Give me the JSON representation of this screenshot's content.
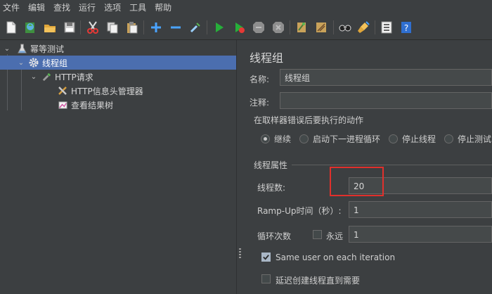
{
  "menu": [
    "文件",
    "编辑",
    "查找",
    "运行",
    "选项",
    "工具",
    "帮助"
  ],
  "toolbar": {
    "icons": [
      "new-icon",
      "templates-icon",
      "open-icon",
      "save-icon",
      "cut-icon",
      "copy-icon",
      "paste-icon",
      "expand-icon",
      "collapse-icon",
      "toggle-icon",
      "start-icon",
      "start-no-pause-icon",
      "stop-icon",
      "shutdown-icon",
      "clear-icon",
      "clear-all-icon",
      "search-icon",
      "reset-search-icon",
      "function-helper-icon",
      "help-icon"
    ]
  },
  "tree": {
    "root": "幂等测试",
    "thread_group": "线程组",
    "http_request": "HTTP请求",
    "header_manager": "HTTP信息头管理器",
    "result_tree": "查看结果树"
  },
  "panel": {
    "title": "线程组",
    "name_label": "名称:",
    "name_value": "线程组",
    "comment_label": "注释:",
    "comment_value": "",
    "error_action_title": "在取样器错误后要执行的动作",
    "error_actions": [
      "继续",
      "启动下一进程循环",
      "停止线程",
      "停止测试"
    ],
    "selected_error_action": "继续",
    "props_title": "线程属性",
    "threads_label": "线程数:",
    "threads_value": "20",
    "rampup_label": "Ramp-Up时间（秒）:",
    "rampup_value": "1",
    "loop_label": "循环次数",
    "forever_label": "永远",
    "forever_checked": false,
    "loop_value": "1",
    "same_user_label": "Same user on each iteration",
    "same_user_checked": true,
    "delay_label": "延迟创建线程直到需要",
    "delay_checked": false
  },
  "colors": {
    "background": "#3c3f41",
    "selection": "#4b6eaf",
    "highlight": "#e0302c"
  }
}
